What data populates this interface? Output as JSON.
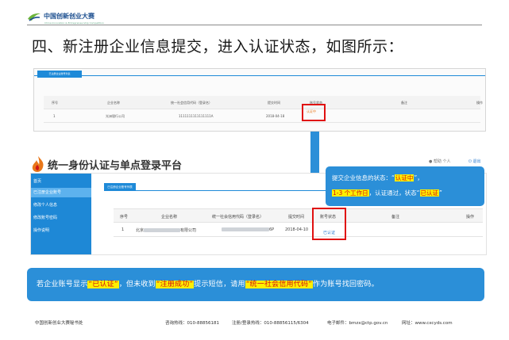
{
  "header": {
    "logo_text": "中国创新创业大赛",
    "logo_sub": "China Innovation & Entrepreneurship Competition"
  },
  "heading": "四、新注册企业信息提交，进入认证状态，如图所示：",
  "screenshot1": {
    "tab": "已注册企业账号列表",
    "columns": [
      "序号",
      "企业名称",
      "统一社会信用代码（登录名）",
      "提交时间",
      "账号状态",
      "备注",
      "操作"
    ],
    "row": [
      "1",
      "光洲银行公司",
      "1111111111111111A",
      "2018-04-18",
      "认证中"
    ]
  },
  "platform": {
    "title": "统一身份认证与单点登录平台",
    "links": "● 帮助  个人",
    "logout": "⏻ 退出",
    "sidebar": [
      "首页",
      "已注册企业账号",
      "修改个人信息",
      "修改账号密码",
      "操作说明"
    ],
    "tab": "已注册企业账号列表",
    "columns": [
      "序号",
      "企业名称",
      "统一社会信用代码（登录名）",
      "提交时间",
      "账号状态",
      "备注",
      "操作"
    ],
    "row": {
      "index": "1",
      "name_prefix": "北京",
      "name_suffix": "有限公司",
      "code_suffix": "6P",
      "date": "2018-04-10",
      "status": "已认证"
    }
  },
  "callout": {
    "l1a": "提交企业信息的状态：“",
    "l1b": "认证中",
    "l1c": "”，",
    "l2a": "1-3 个工作日",
    "l2b": "，认证通过，状态“",
    "l2c": "已认证",
    "l2d": "”"
  },
  "banner": {
    "p1": "若企业账号显示",
    "h1": "“已认证”",
    "p2": "，但未收到",
    "h2": "“注册成功”",
    "p3": "提示短信，请用",
    "h3": "“统一社会信用代码”",
    "p4": "作为账号找回密码。"
  },
  "footer": {
    "org": "中国创新创业大赛秘书处",
    "hotline": "咨询热线：010-88856181",
    "reg": "注册/登录热线：010-88856115/6304",
    "email": "电子邮件：bmzx@ctp.gov.cn",
    "site": "网址：www.cxcyds.com"
  },
  "colors": {
    "accent": "#2b8fd8",
    "highlight": "#ffef00",
    "alert": "#e01010"
  }
}
